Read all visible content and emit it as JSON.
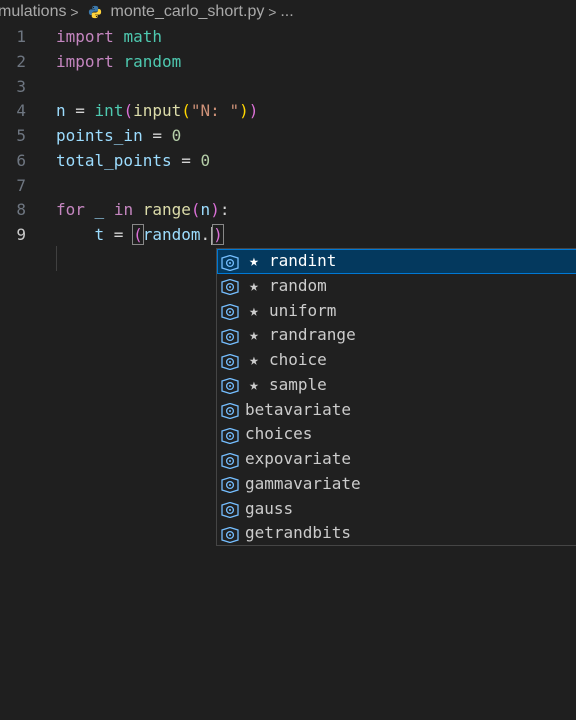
{
  "breadcrumb": {
    "folder": "mulations",
    "file": "monte_carlo_short.py",
    "trail": "..."
  },
  "editor": {
    "active_line": 9,
    "lines": [
      {
        "n": "1",
        "tokens": [
          [
            "kw",
            "import"
          ],
          [
            "op",
            " "
          ],
          [
            "mod",
            "math"
          ]
        ]
      },
      {
        "n": "2",
        "tokens": [
          [
            "kw",
            "import"
          ],
          [
            "op",
            " "
          ],
          [
            "mod",
            "random"
          ]
        ]
      },
      {
        "n": "3",
        "tokens": []
      },
      {
        "n": "4",
        "tokens": [
          [
            "var",
            "n"
          ],
          [
            "op",
            " = "
          ],
          [
            "mod",
            "int"
          ],
          [
            "bracket1",
            "("
          ],
          [
            "fn",
            "input"
          ],
          [
            "bracket2",
            "("
          ],
          [
            "str",
            "\"N: \""
          ],
          [
            "bracket2",
            ")"
          ],
          [
            "bracket1",
            ")"
          ]
        ]
      },
      {
        "n": "5",
        "tokens": [
          [
            "var",
            "points_in"
          ],
          [
            "op",
            " = "
          ],
          [
            "num",
            "0"
          ]
        ]
      },
      {
        "n": "6",
        "tokens": [
          [
            "var",
            "total_points"
          ],
          [
            "op",
            " = "
          ],
          [
            "num",
            "0"
          ]
        ]
      },
      {
        "n": "7",
        "tokens": []
      },
      {
        "n": "8",
        "tokens": [
          [
            "kw",
            "for"
          ],
          [
            "op",
            " "
          ],
          [
            "var",
            "_"
          ],
          [
            "op",
            " "
          ],
          [
            "kw",
            "in"
          ],
          [
            "op",
            " "
          ],
          [
            "fn",
            "range"
          ],
          [
            "bracket1",
            "("
          ],
          [
            "var",
            "n"
          ],
          [
            "bracket1",
            ")"
          ],
          [
            "op",
            ":"
          ]
        ]
      },
      {
        "n": "9",
        "tokens": [
          [
            "op",
            "    "
          ],
          [
            "var",
            "t"
          ],
          [
            "op",
            " = "
          ],
          [
            "bracket1",
            "("
          ],
          [
            "var",
            "random"
          ],
          [
            "op",
            "."
          ],
          [
            "bracket1",
            ")"
          ]
        ]
      }
    ]
  },
  "suggestions": [
    {
      "label": "randint",
      "starred": true,
      "selected": true
    },
    {
      "label": "random",
      "starred": true,
      "selected": false
    },
    {
      "label": "uniform",
      "starred": true,
      "selected": false
    },
    {
      "label": "randrange",
      "starred": true,
      "selected": false
    },
    {
      "label": "choice",
      "starred": true,
      "selected": false
    },
    {
      "label": "sample",
      "starred": true,
      "selected": false
    },
    {
      "label": "betavariate",
      "starred": false,
      "selected": false
    },
    {
      "label": "choices",
      "starred": false,
      "selected": false
    },
    {
      "label": "expovariate",
      "starred": false,
      "selected": false
    },
    {
      "label": "gammavariate",
      "starred": false,
      "selected": false
    },
    {
      "label": "gauss",
      "starred": false,
      "selected": false
    },
    {
      "label": "getrandbits",
      "starred": false,
      "selected": false
    }
  ],
  "icons": {
    "breadcrumb_separator": "chevron-right-icon",
    "file_type": "python-icon",
    "suggestion_kind": "variable-symbol-icon",
    "suggestion_star": "star-icon"
  },
  "colors": {
    "keyword": "#c586c0",
    "module": "#4ec9b0",
    "variable": "#9cdcfe",
    "string": "#ce9178",
    "number": "#b5cea8",
    "function": "#dcdcaa",
    "selection": "#04395e",
    "symbol_icon": "#75beff"
  }
}
